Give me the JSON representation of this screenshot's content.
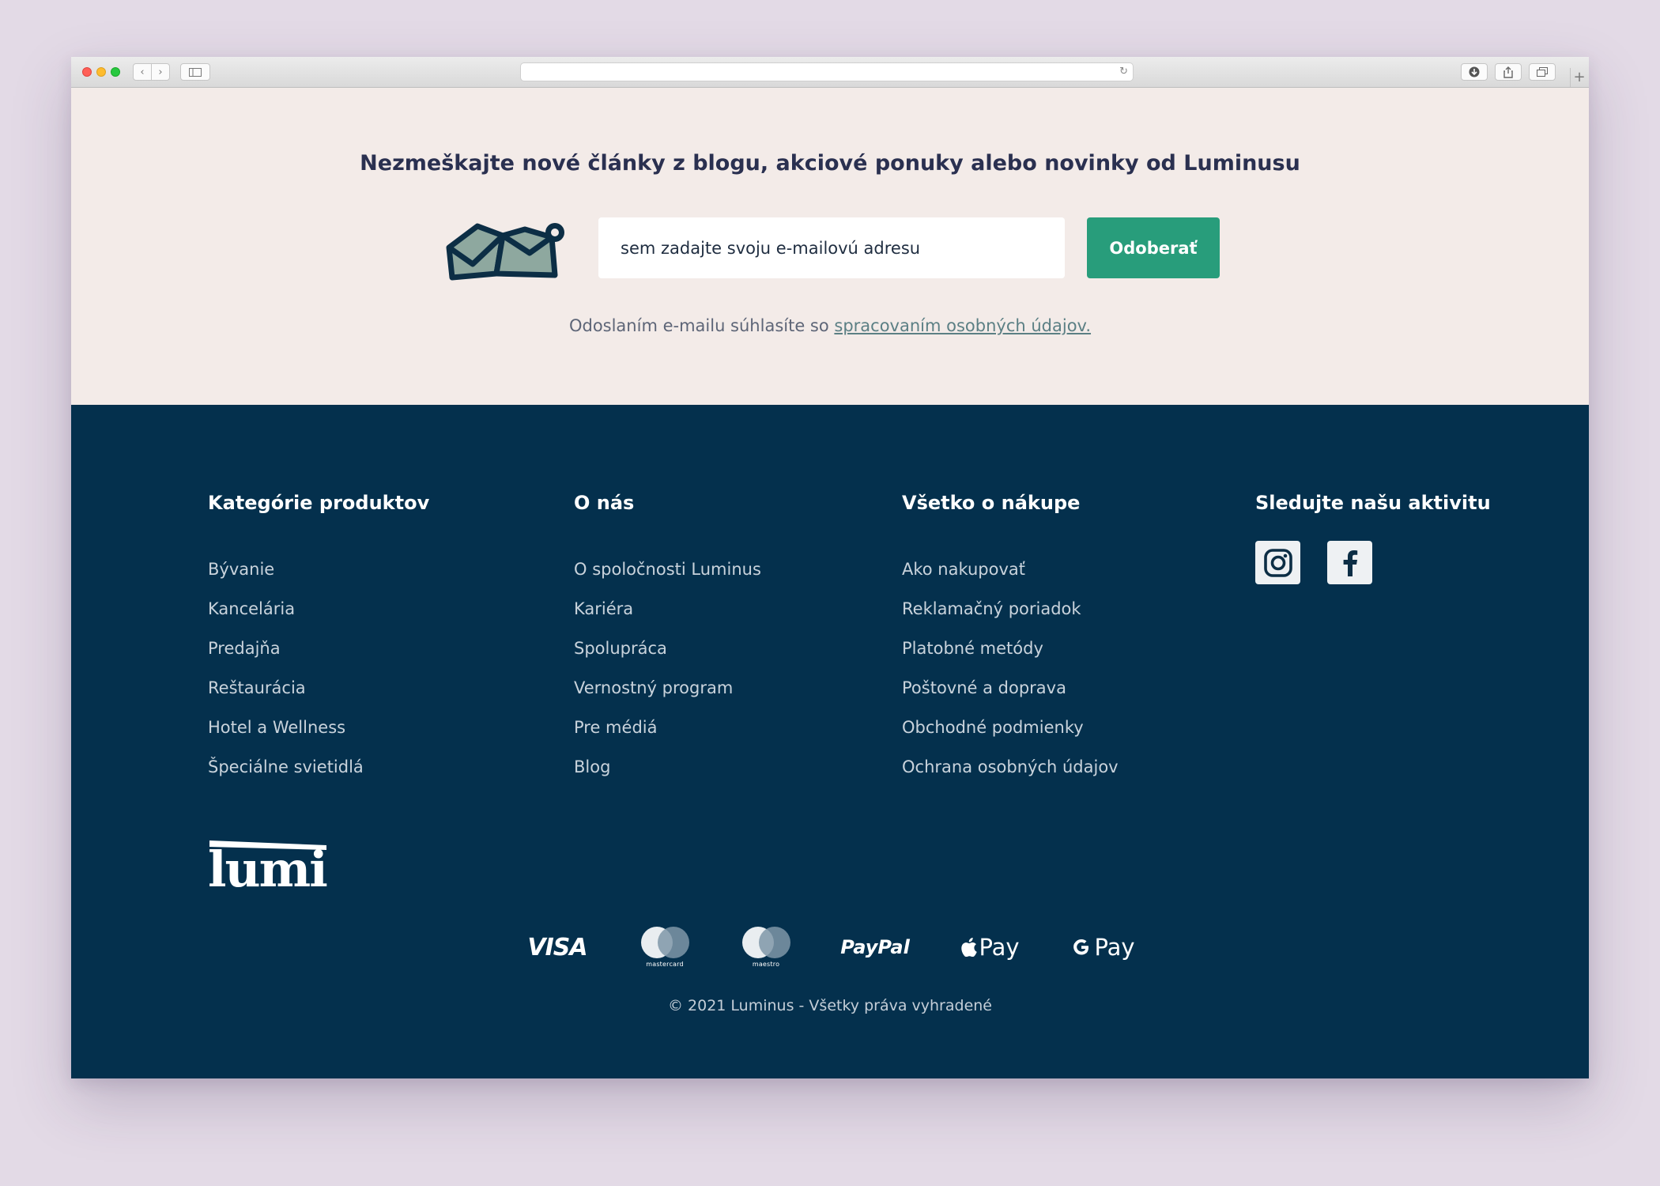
{
  "newsletter": {
    "title": "Nezmeškajte nové články z blogu, akciové ponuky alebo novinky od Luminusu",
    "email_placeholder": "sem zadajte svoju e-mailovú adresu",
    "subscribe_label": "Odoberať",
    "consent_text": "Odoslaním e-mailu súhlasíte so ",
    "consent_link": "spracovaním osobných údajov."
  },
  "footer": {
    "columns": [
      {
        "heading": "Kategórie produktov",
        "links": [
          "Bývanie",
          "Kancelária",
          "Predajňa",
          "Reštaurácia",
          "Hotel a Wellness",
          "Špeciálne svietidlá"
        ]
      },
      {
        "heading": "O nás",
        "links": [
          "O spoločnosti Luminus",
          "Kariéra",
          "Spolupráca",
          "Vernostný program",
          "Pre médiá",
          "Blog"
        ]
      },
      {
        "heading": "Všetko o nákupe",
        "links": [
          "Ako nakupovať",
          "Reklamačný poriadok",
          "Platobné metódy",
          "Poštovné a doprava",
          "Obchodné podmienky",
          "Ochrana osobných údajov"
        ]
      }
    ],
    "social": {
      "heading": "Sledujte našu aktivitu",
      "icons": [
        "instagram-icon",
        "facebook-icon"
      ]
    },
    "logo_text": "lumi",
    "payments": {
      "visa": "VISA",
      "mastercard": "mastercard",
      "maestro": "maestro",
      "paypal": "PayPal",
      "apple_pay": "Pay",
      "google_pay": "Pay"
    },
    "copyright": "© 2021 Luminus - Všetky práva vyhradené"
  },
  "colors": {
    "newsletter_bg": "#f3ebe8",
    "footer_bg": "#04304d",
    "accent_button": "#289d7b",
    "heading_text": "#2a3050"
  }
}
